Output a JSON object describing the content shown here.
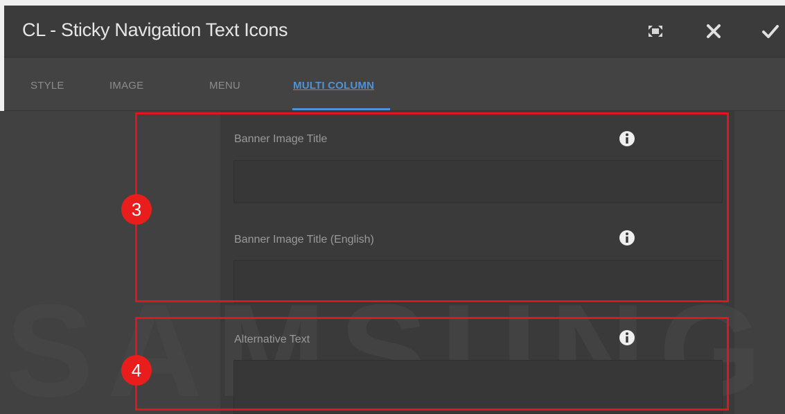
{
  "dialog": {
    "title": "CL - Sticky Navigation Text Icons",
    "fullscreen_icon": "fullscreen-icon",
    "close_icon": "close-icon",
    "confirm_icon": "checkmark-icon"
  },
  "tabs": [
    {
      "label": "STYLE",
      "active": false
    },
    {
      "label": "IMAGE",
      "active": false
    },
    {
      "label": "MENU",
      "active": false
    },
    {
      "label": "MULTI COLUMN",
      "active": true
    }
  ],
  "fields": [
    {
      "label": "Banner Image Title",
      "value": "",
      "info_icon": "info-icon"
    },
    {
      "label": "Banner Image Title (English)",
      "value": "",
      "info_icon": "info-icon"
    },
    {
      "label": "Alternative Text",
      "value": "",
      "info_icon": "info-icon"
    }
  ],
  "annotations": [
    {
      "number": "3"
    },
    {
      "number": "4"
    }
  ],
  "watermark": {
    "text": "SAMSUNG"
  },
  "colors": {
    "accent": "#4e93d8",
    "highlight": "#e2141c",
    "badge": "#ea1d1d"
  }
}
